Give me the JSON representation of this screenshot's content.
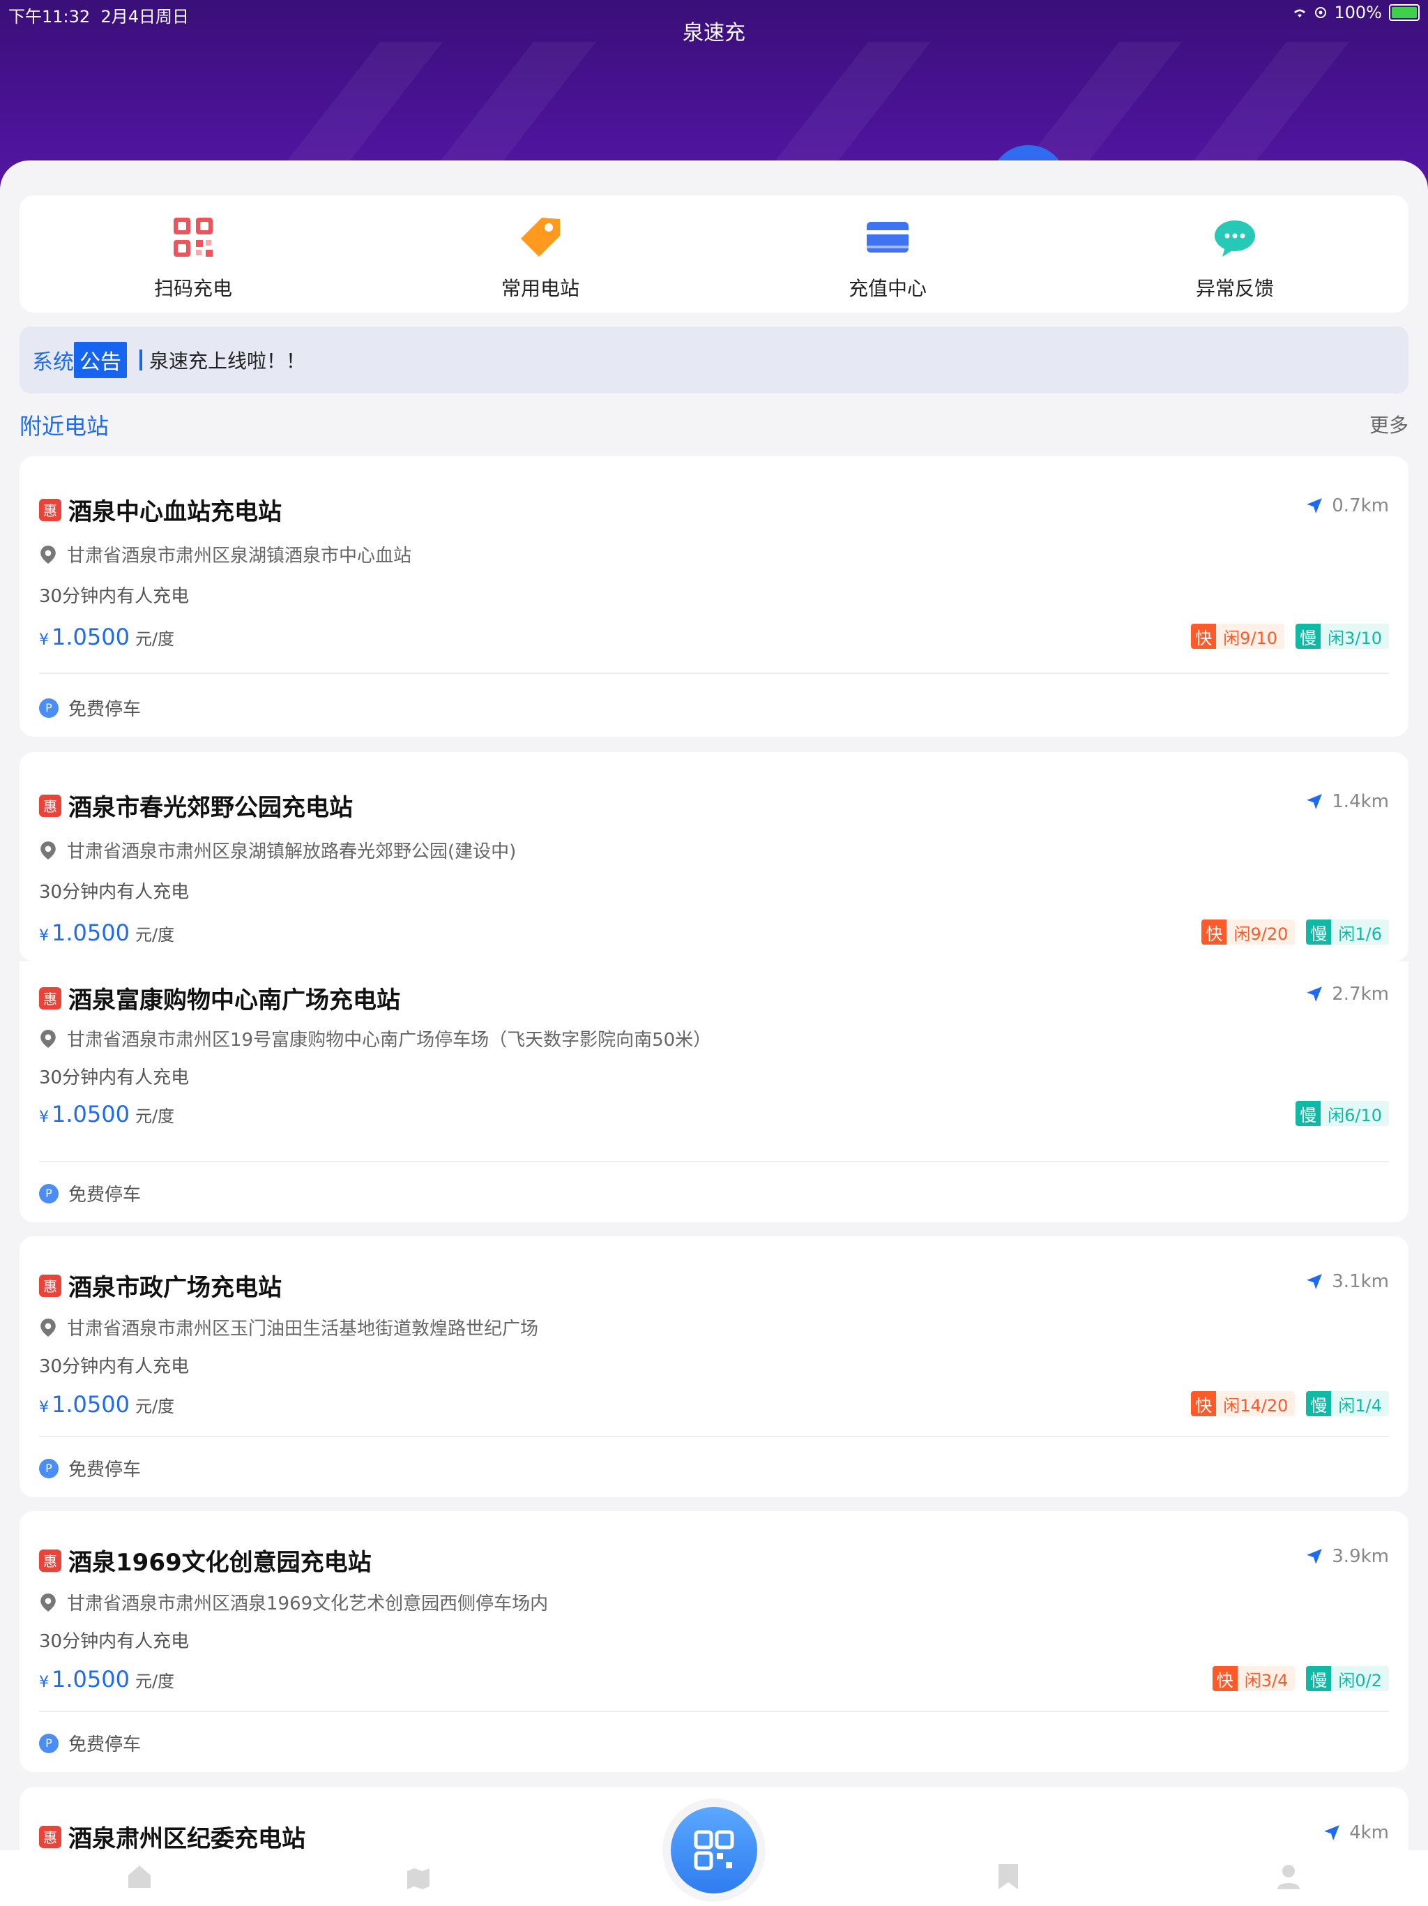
{
  "status_bar": {
    "time": "下午11:32",
    "date": "2月4日周日",
    "battery": "100%"
  },
  "app": {
    "title": "泉速充"
  },
  "quick_actions": [
    {
      "label": "扫码充电",
      "icon": "qr-code-icon"
    },
    {
      "label": "常用电站",
      "icon": "tag-icon"
    },
    {
      "label": "充值中心",
      "icon": "card-icon"
    },
    {
      "label": "异常反馈",
      "icon": "chat-bubble-icon"
    }
  ],
  "notice": {
    "tag_part1": "系统",
    "tag_part2": "公告",
    "text": "泉速充上线啦！！"
  },
  "nearby": {
    "title": "附近电站",
    "more": "更多"
  },
  "common": {
    "hui": "惠",
    "wait": "30分钟内有人充电",
    "price_symbol": "¥",
    "unit": "元/度",
    "parking": "免费停车",
    "parking_icon": "P",
    "fast_label": "快",
    "slow_label": "慢"
  },
  "stations": [
    {
      "name": "酒泉中心血站充电站",
      "distance": "0.7km",
      "address": "甘肃省酒泉市肃州区泉湖镇酒泉市中心血站",
      "price": "1.0500",
      "fast": "闲9/10",
      "slow": "闲3/10",
      "parking": true
    },
    {
      "name": "酒泉市春光郊野公园充电站",
      "distance": "1.4km",
      "address": "甘肃省酒泉市肃州区泉湖镇解放路春光郊野公园(建设中)",
      "price": "1.0500",
      "fast": "闲9/20",
      "slow": "闲1/6",
      "parking": false
    },
    {
      "name": "酒泉富康购物中心南广场充电站",
      "distance": "2.7km",
      "address": "甘肃省酒泉市肃州区19号富康购物中心南广场停车场（飞天数字影院向南50米）",
      "price": "1.0500",
      "fast": null,
      "slow": "闲6/10",
      "parking": true
    },
    {
      "name": "酒泉市政广场充电站",
      "distance": "3.1km",
      "address": "甘肃省酒泉市肃州区玉门油田生活基地街道敦煌路世纪广场",
      "price": "1.0500",
      "fast": "闲14/20",
      "slow": "闲1/4",
      "parking": true
    },
    {
      "name": "酒泉1969文化创意园充电站",
      "distance": "3.9km",
      "address": "甘肃省酒泉市肃州区酒泉1969文化艺术创意园西侧停车场内",
      "price": "1.0500",
      "fast": "闲3/4",
      "slow": "闲0/2",
      "parking": true
    },
    {
      "name": "酒泉肃州区纪委充电站",
      "distance": "4km"
    }
  ],
  "tabbar": [
    "home-icon",
    "map-icon",
    "scan-icon",
    "bookmark-icon",
    "user-icon"
  ],
  "colors": {
    "accent": "#1e6bf0",
    "header": "#4b1398",
    "fast": "#ff5a2a",
    "slow": "#10b9a5",
    "hui": "#e8443a"
  }
}
